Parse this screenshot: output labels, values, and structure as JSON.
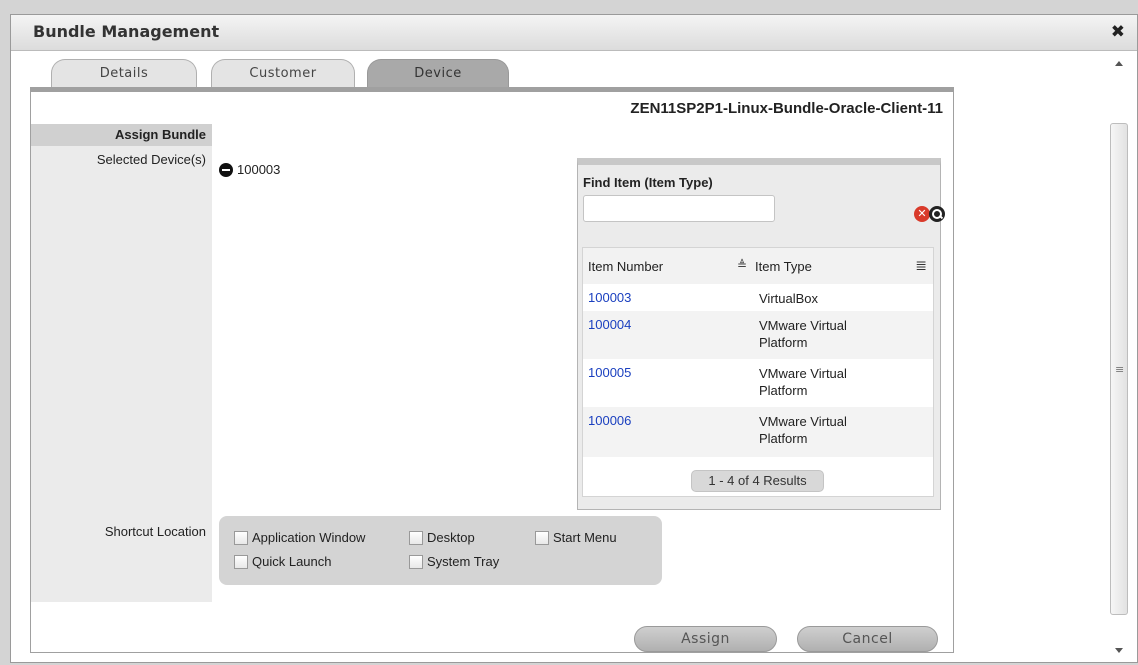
{
  "dialog": {
    "title": "Bundle Management",
    "close_glyph": "✖"
  },
  "tabs": [
    {
      "label": "Details",
      "active": false
    },
    {
      "label": "Customer",
      "active": false
    },
    {
      "label": "Device",
      "active": true
    }
  ],
  "bundle_name": "ZEN11SP2P1-Linux-Bundle-Oracle-Client-11",
  "form": {
    "section_title": "Assign Bundle",
    "selected_devices_label": "Selected Device(s)",
    "selected_device": "100003",
    "shortcut_location_label": "Shortcut Location",
    "shortcut_options": [
      {
        "label": "Application Window",
        "checked": false
      },
      {
        "label": "Desktop",
        "checked": false
      },
      {
        "label": "Start Menu",
        "checked": false
      },
      {
        "label": "Quick Launch",
        "checked": false
      },
      {
        "label": "System Tray",
        "checked": false
      }
    ]
  },
  "find_item": {
    "title": "Find Item (Item Type)",
    "input_value": "",
    "columns": [
      "Item Number",
      "Item Type"
    ],
    "sort_glyph": "≜",
    "columns_glyph": "≣",
    "rows": [
      {
        "number": "100003",
        "type_lines": [
          "VirtualBox"
        ]
      },
      {
        "number": "100004",
        "type_lines": [
          "VMware Virtual",
          "Platform"
        ]
      },
      {
        "number": "100005",
        "type_lines": [
          "VMware Virtual",
          "Platform"
        ]
      },
      {
        "number": "100006",
        "type_lines": [
          "VMware Virtual",
          "Platform"
        ]
      }
    ],
    "pager": "1 - 4 of 4 Results"
  },
  "actions": {
    "assign": "Assign",
    "cancel": "Cancel"
  },
  "scrollbar": {
    "grip": "≡"
  }
}
